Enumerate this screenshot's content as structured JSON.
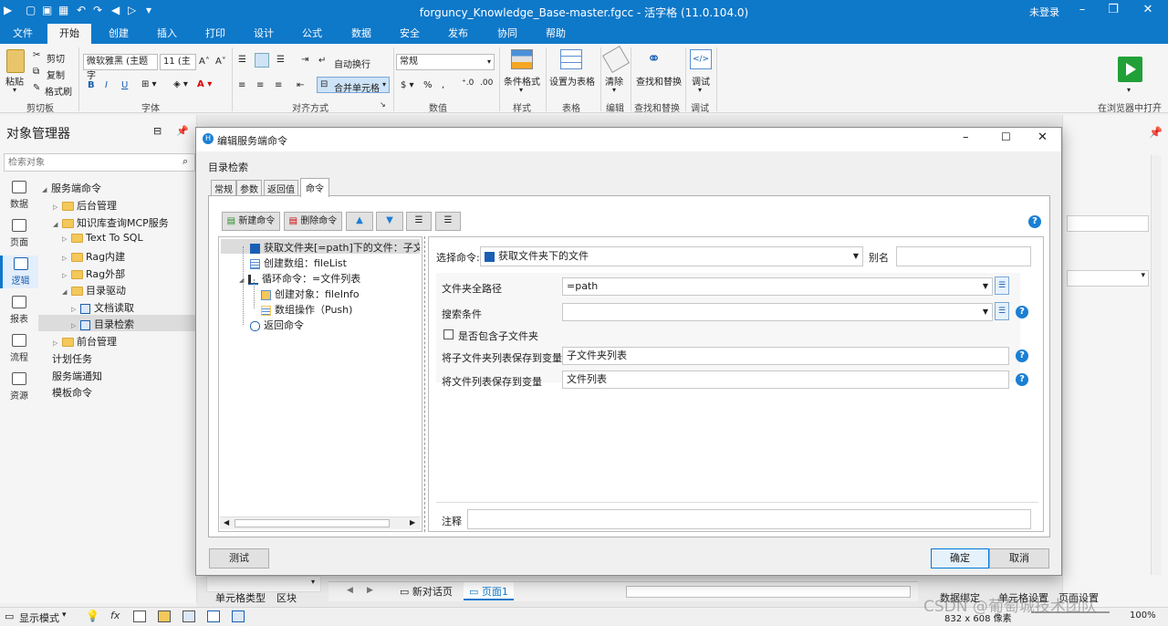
{
  "titlebar": {
    "title": "forguncy_Knowledge_Base-master.fgcc - 活字格 (11.0.104.0)",
    "login": "未登录"
  },
  "menu": [
    "文件",
    "开始",
    "创建",
    "插入",
    "打印",
    "设计",
    "公式",
    "数据",
    "安全",
    "发布",
    "协同",
    "帮助"
  ],
  "ribbon": {
    "paste": "粘贴",
    "cut": "剪切",
    "copy": "复制",
    "format_painter": "格式刷",
    "group_clipboard": "剪切板",
    "font_name": "微软雅黑 (主题字",
    "font_size": "11 (主",
    "group_font": "字体",
    "wrap": "自动换行",
    "merge": "合并单元格",
    "group_align": "对齐方式",
    "number_format": "常规",
    "group_number": "数值",
    "cond_format": "条件格式",
    "group_style": "样式",
    "set_table": "设置为表格",
    "group_table": "表格",
    "clear": "清除",
    "group_edit": "编辑",
    "find_replace": "查找和替换",
    "group_find": "查找和替换",
    "debug": "调试",
    "group_debug": "调试",
    "open_browser": "在浏览器中打开"
  },
  "left": {
    "title": "对象管理器",
    "search_placeholder": "检索对象",
    "nav": [
      {
        "label": "数据",
        "icon": "table-icon"
      },
      {
        "label": "页面",
        "icon": "page-icon"
      },
      {
        "label": "逻辑",
        "icon": "logic-icon"
      },
      {
        "label": "报表",
        "icon": "report-icon"
      },
      {
        "label": "流程",
        "icon": "flow-icon"
      },
      {
        "label": "资源",
        "icon": "image-icon"
      }
    ],
    "tree": {
      "root": "服务端命令",
      "backend": "后台管理",
      "mcp": "知识库查询MCP服务",
      "text_to_sql": "Text To SQL",
      "rag_in": "Rag内建",
      "rag_out": "Rag外部",
      "dir_driver": "目录驱动",
      "doc_read": "文档读取",
      "dir_search": "目录检索",
      "frontend": "前台管理",
      "schedule": "计划任务",
      "notify": "服务端通知",
      "template": "模板命令"
    }
  },
  "dialog": {
    "title": "编辑服务端命令",
    "name": "目录检索",
    "tabs": [
      "常规",
      "参数",
      "返回值",
      "命令"
    ],
    "new_cmd": "新建命令",
    "del_cmd": "删除命令",
    "commands": [
      "获取文件夹[=path]下的文件：子文件夹",
      "创建数组：fileList",
      "循环命令：=文件列表",
      "创建对象：fileInfo",
      "数组操作（Push)",
      "返回命令"
    ],
    "select_cmd_label": "选择命令:",
    "select_cmd_value": "获取文件夹下的文件",
    "alias_label": "别名",
    "alias_value": "",
    "folder_path_label": "文件夹全路径",
    "folder_path_value": "=path",
    "search_label": "搜索条件",
    "search_value": "",
    "include_sub_label": "是否包含子文件夹",
    "save_sub_label": "将子文件夹列表保存到变量",
    "save_sub_value": "子文件夹列表",
    "save_files_label": "将文件列表保存到变量",
    "save_files_value": "文件列表",
    "note_label": "注释",
    "note_value": "",
    "test": "测试",
    "ok": "确定",
    "cancel": "取消"
  },
  "bottom": {
    "cell_type": "单元格类型",
    "block": "区块",
    "tab_new": "新对话页",
    "tab_page": "页面1",
    "data_bind": "数据绑定",
    "cell_setting": "单元格设置",
    "page_setting": "页面设置",
    "display_mode": "显示模式",
    "size": "832 x 608 像素",
    "zoom": "100%",
    "watermark": "CSDN @葡萄城技术团队"
  }
}
